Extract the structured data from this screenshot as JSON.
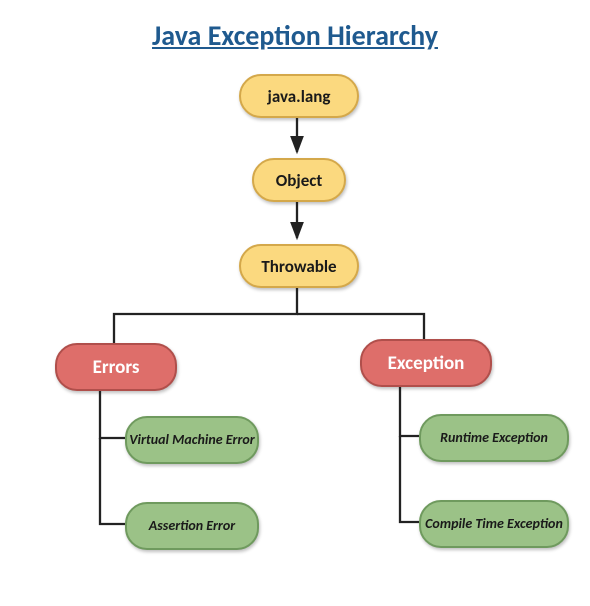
{
  "title": "Java Exception Hierarchy ",
  "nodes": {
    "java_lang": "java.lang",
    "object": "Object",
    "throwable": "Throwable",
    "errors": "Errors",
    "exception": "Exception",
    "vm_error": "Virtual Machine Error",
    "assertion_error": "Assertion Error",
    "runtime_exception": "Runtime Exception",
    "compile_time_exception": "Compile Time Exception"
  }
}
